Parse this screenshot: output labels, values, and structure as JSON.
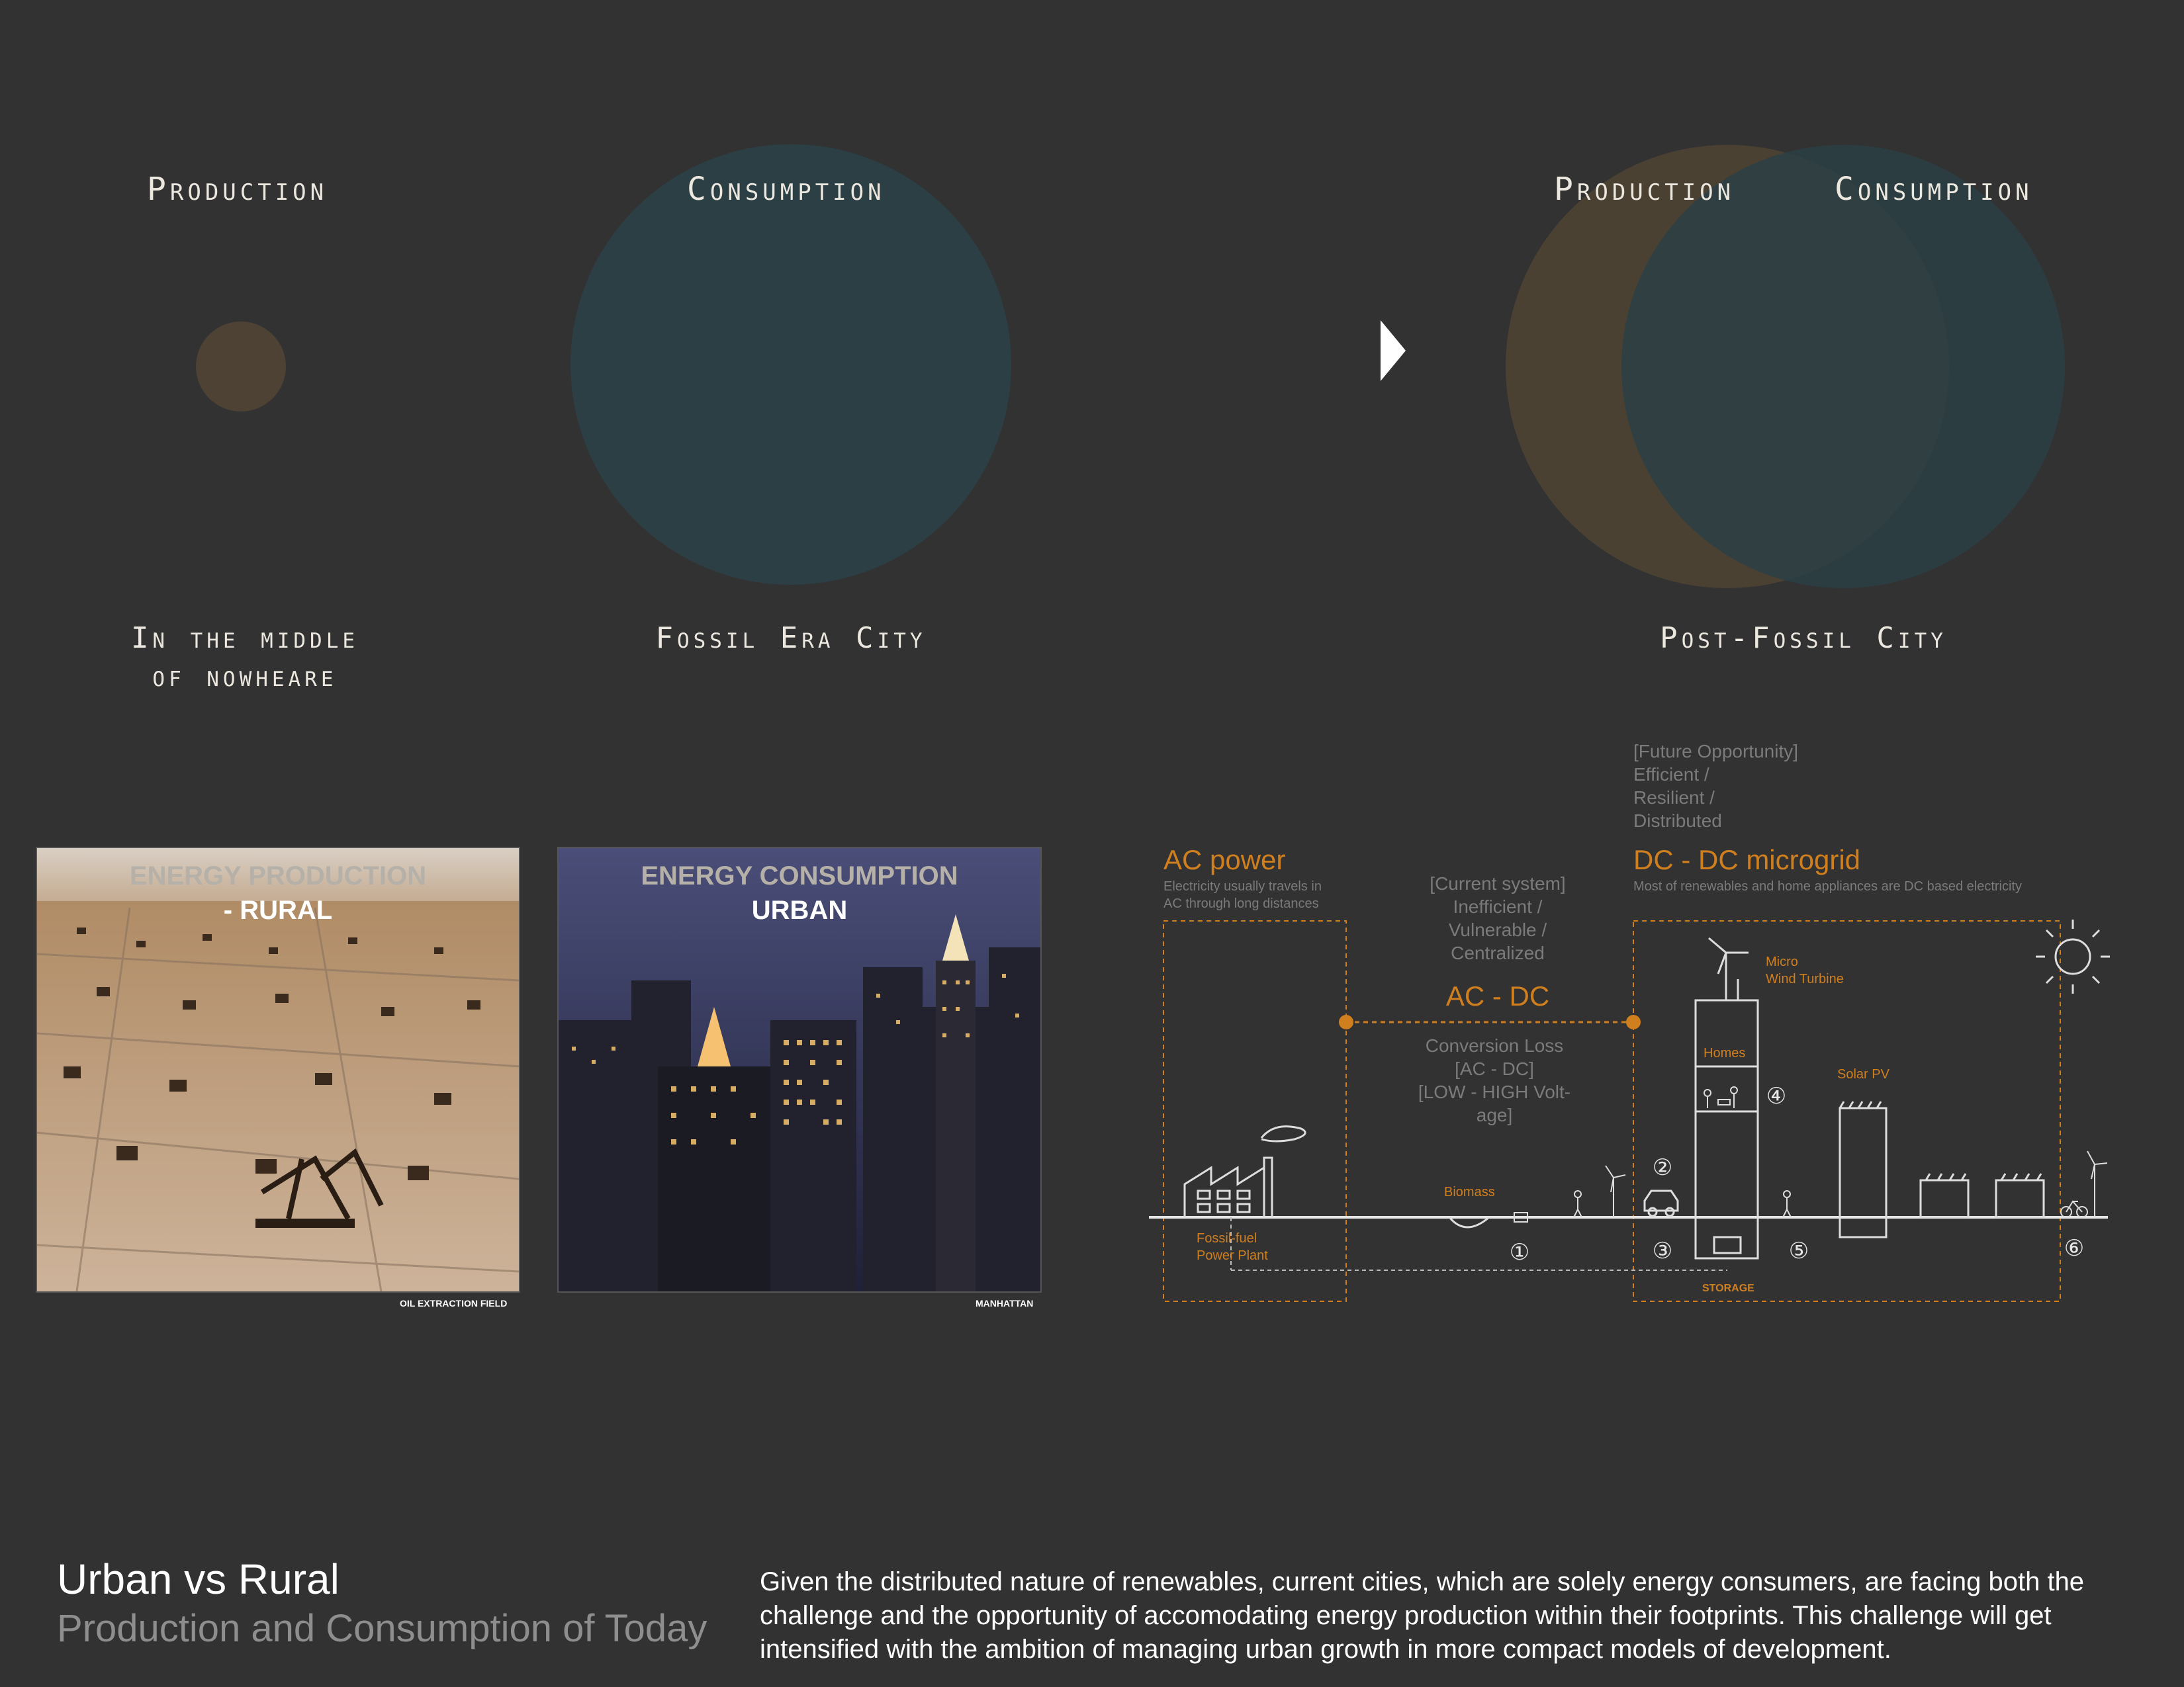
{
  "venn": {
    "left_group": {
      "production_label": "Production",
      "consumption_label": "Consumption"
    },
    "right_group": {
      "production_label": "Production",
      "consumption_label": "Consumption"
    },
    "captions": {
      "nowhere_line1": "In the middle",
      "nowhere_line2": "of nowheare",
      "fossil": "Fossil Era City",
      "post_fossil": "Post-Fossil City"
    },
    "colors": {
      "production": "#4d4234",
      "consumption": "#2c3f45"
    }
  },
  "photos": {
    "rural": {
      "heading_line1": "ENERGY PRODUCTION",
      "heading_line2": "- RURAL",
      "credit": "OIL EXTRACTION FIELD"
    },
    "urban": {
      "heading_line1": "ENERGY CONSUMPTION",
      "heading_line2": "URBAN",
      "credit": "MANHATTAN"
    }
  },
  "diagram": {
    "future_line1": "[Future Opportunity]",
    "future_line2": "Efficient /",
    "future_line3": "Resilient /",
    "future_line4": "Distributed",
    "ac_title": "AC power",
    "ac_desc_line1": "Electricity usually travels in",
    "ac_desc_line2": "AC through long distances",
    "current_line1": "[Current system]",
    "current_line2": "Inefficient /",
    "current_line3": "Vulnerable /",
    "current_line4": "Centralized",
    "acdc_title": "AC - DC",
    "loss_line1": "Conversion Loss",
    "loss_line2": "[AC - DC]",
    "loss_line3": "[LOW - HIGH Volt-",
    "loss_line4": "age]",
    "dc_title": "DC - DC microgrid",
    "dc_desc": "Most of renewables and home appliances are DC based electricity",
    "micro_line1": "Micro",
    "micro_line2": "Wind Turbine",
    "homes": "Homes",
    "solar": "Solar PV",
    "biomass": "Biomass",
    "fossil_line1": "Fossil-fuel",
    "fossil_line2": "Power Plant",
    "storage": "STORAGE",
    "n1": "①",
    "n2": "②",
    "n3": "③",
    "n4": "④",
    "n5": "⑤",
    "n6": "⑥",
    "accent_color": "#d07f1f"
  },
  "footer": {
    "title": "Urban vs Rural",
    "subtitle": "Production and Consumption of Today",
    "description": "Given the distributed nature of renewables, current cities, which are solely energy consumers, are facing both the challenge and the opportunity of accomodating energy production within their footprints. This challenge will get intensified with the ambition of managing urban growth in more compact models of development."
  }
}
